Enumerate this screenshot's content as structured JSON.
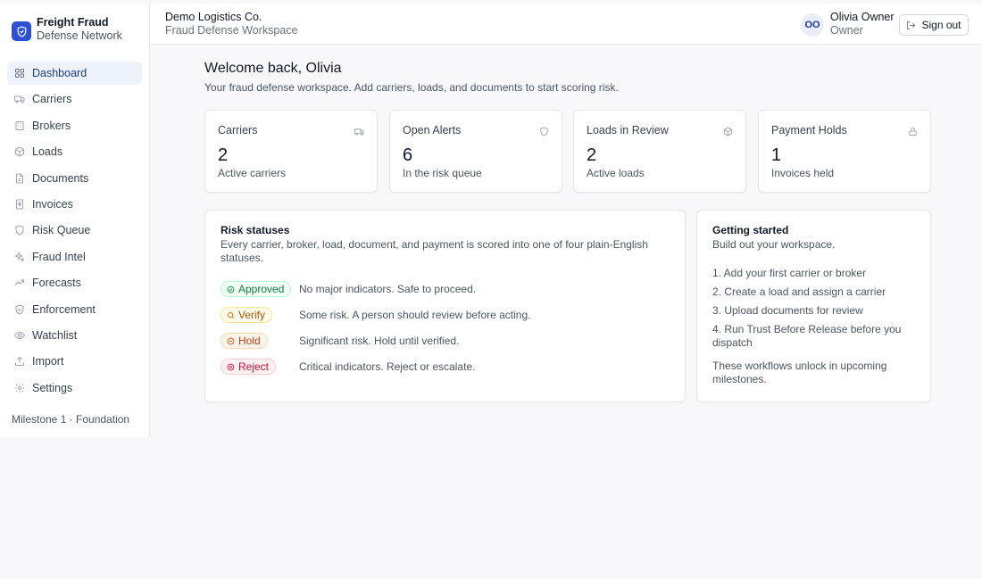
{
  "brand": {
    "title": "Freight Fraud",
    "subtitle": "Defense Network",
    "accent": "#2c4fd6"
  },
  "sidebar": {
    "items": [
      {
        "label": "Dashboard",
        "icon": "dashboard-grid-icon",
        "active": true
      },
      {
        "label": "Carriers",
        "icon": "truck-icon"
      },
      {
        "label": "Brokers",
        "icon": "building-icon"
      },
      {
        "label": "Loads",
        "icon": "package-icon"
      },
      {
        "label": "Documents",
        "icon": "document-icon"
      },
      {
        "label": "Invoices",
        "icon": "receipt-icon"
      },
      {
        "label": "Risk Queue",
        "icon": "shield-icon"
      },
      {
        "label": "Fraud Intel",
        "icon": "sparkles-icon"
      },
      {
        "label": "Forecasts",
        "icon": "trending-up-icon"
      },
      {
        "label": "Enforcement",
        "icon": "shield-check-icon"
      },
      {
        "label": "Watchlist",
        "icon": "eye-icon"
      },
      {
        "label": "Import",
        "icon": "upload-icon"
      },
      {
        "label": "Settings",
        "icon": "gear-icon"
      }
    ],
    "milestone": "Milestone 1 · Foundation"
  },
  "header": {
    "org_name": "Demo Logistics Co.",
    "org_sub": "Fraud Defense Workspace",
    "avatar_initials": "OO",
    "user_name": "Olivia Owner",
    "user_role": "Owner",
    "signout_label": "Sign out"
  },
  "welcome": {
    "title": "Welcome back, Olivia",
    "subtitle": "Your fraud defense workspace. Add carriers, loads, and documents to start scoring risk."
  },
  "stats": [
    {
      "label": "Carriers",
      "value": "2",
      "caption": "Active carriers",
      "icon": "truck-icon"
    },
    {
      "label": "Open Alerts",
      "value": "6",
      "caption": "In the risk queue",
      "icon": "shield-icon"
    },
    {
      "label": "Loads in Review",
      "value": "2",
      "caption": "Active loads",
      "icon": "package-icon"
    },
    {
      "label": "Payment Holds",
      "value": "1",
      "caption": "Invoices held",
      "icon": "lock-icon"
    }
  ],
  "risk_statuses": {
    "title": "Risk statuses",
    "description": "Every carrier, broker, load, document, and payment is scored into one of four plain-English statuses.",
    "items": [
      {
        "label": "Approved",
        "text": "No major indicators. Safe to proceed.",
        "color": "#15803d",
        "bg": "#f0fdf4",
        "border": "#bbf7d0",
        "icon": "check-circle-icon"
      },
      {
        "label": "Verify",
        "text": "Some risk. A person should review before acting.",
        "color": "#b45309",
        "bg": "#fffbeb",
        "border": "#fde68a",
        "icon": "search-icon"
      },
      {
        "label": "Hold",
        "text": "Significant risk. Hold until verified.",
        "color": "#c2410c",
        "bg": "#fff7ed",
        "border": "#fed7aa",
        "icon": "pause-circle-icon"
      },
      {
        "label": "Reject",
        "text": "Critical indicators. Reject or escalate.",
        "color": "#be123c",
        "bg": "#fff1f2",
        "border": "#fecdd3",
        "icon": "x-circle-icon"
      }
    ]
  },
  "getting_started": {
    "title": "Getting started",
    "subtitle": "Build out your workspace.",
    "steps": [
      "1. Add your first carrier or broker",
      "2. Create a load and assign a carrier",
      "3. Upload documents for review",
      "4. Run Trust Before Release before you dispatch"
    ],
    "note": "These workflows unlock in upcoming milestones."
  }
}
